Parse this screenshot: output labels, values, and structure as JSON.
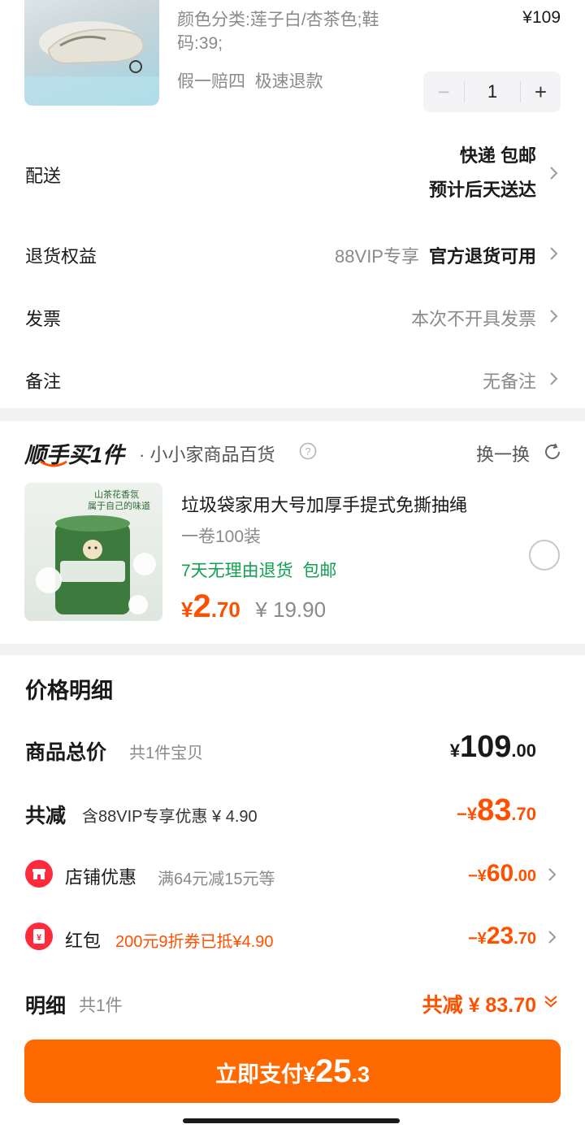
{
  "product": {
    "spec_line1": "颜色分类:莲子白/杏茶色;鞋",
    "spec_line2": "码:39;",
    "price": "¥109",
    "services": "假一赔四  极速退款",
    "quantity": "1",
    "minus": "−",
    "plus": "+"
  },
  "delivery": {
    "label": "配送",
    "method": "快递 包邮",
    "eta": "预计后天送达"
  },
  "returns": {
    "label": "退货权益",
    "vip": "88VIP专享",
    "value": "官方退货可用"
  },
  "invoice": {
    "label": "发票",
    "value": "本次不开具发票"
  },
  "note": {
    "label": "备注",
    "value": "无备注"
  },
  "addon": {
    "brand": "顺手买1件",
    "store": "· 小小家商品百货",
    "help_icon": "question-circle-icon",
    "swap_label": "换一换",
    "title": "垃圾袋家用大号加厚手提式免撕抽绳",
    "subtitle": "一卷100装",
    "image_text_line1": "山茶花香氛",
    "image_text_line2": "属于自己的味道",
    "benefits": "7天无理由退货  包邮",
    "price_symbol": "¥",
    "price_int": "2",
    "price_dec": ".70",
    "original_price": "¥ 19.90"
  },
  "price_detail": {
    "heading": "价格明细",
    "goods_total_label": "商品总价",
    "goods_total_sub": "共1件宝贝",
    "goods_total_symbol": "¥",
    "goods_total_int": "109",
    "goods_total_dec": ".00",
    "discount_label": "共减",
    "discount_sub": "含88VIP专享优惠 ¥ 4.90",
    "discount_symbol": "−¥",
    "discount_int": "83",
    "discount_dec": ".70",
    "shop_label": "店铺优惠",
    "shop_sub": "满64元减15元等",
    "shop_symbol": "−¥",
    "shop_int": "60",
    "shop_dec": ".00",
    "redpacket_label": "红包",
    "redpacket_sub": "200元9折券已抵¥4.90",
    "redpacket_symbol": "−¥",
    "redpacket_int": "23",
    "redpacket_dec": ".70",
    "detail_label": "明细",
    "detail_sub": "共1件",
    "detail_total": "共减 ¥ 83.70"
  },
  "pay": {
    "label": "立即支付",
    "symbol": "¥",
    "amount_int": "25",
    "amount_dec": ".3"
  },
  "colors": {
    "accent": "#ff5000",
    "pay_button": "#ff6a00",
    "green": "#12a150",
    "shop_icon": "#ff2b3a"
  }
}
